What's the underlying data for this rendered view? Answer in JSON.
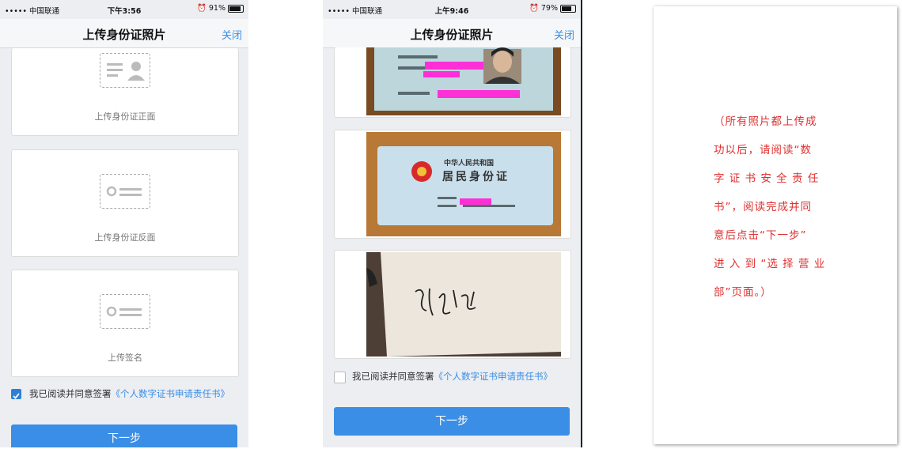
{
  "left_phone": {
    "status": {
      "carrier": "••••• 中国联通",
      "time": "下午3:56",
      "battery": "91%",
      "battery_level": 0.91
    },
    "nav": {
      "title": "上传身份证照片",
      "close": "关闭"
    },
    "cards": [
      {
        "label": "上传身份证正面"
      },
      {
        "label": "上传身份证反面"
      },
      {
        "label": "上传签名"
      }
    ],
    "agreement": {
      "checked": true,
      "text": "我已阅读并同意签署",
      "link": "《个人数字证书申请责任书》"
    },
    "button": "下一步"
  },
  "right_phone": {
    "status": {
      "carrier": "••••• 中国联通",
      "time": "上午9:46",
      "battery": "79%",
      "battery_level": 0.79
    },
    "nav": {
      "title": "上传身份证照片",
      "close": "关闭"
    },
    "id_back": {
      "line1": "中华人民共和国",
      "line2": "居民身份证"
    },
    "agreement": {
      "checked": false,
      "text": "我已阅读并同意签署",
      "link": "《个人数字证书申请责任书》"
    },
    "button": "下一步"
  },
  "note": {
    "lines": [
      "（所有照片都上传成",
      "功以后，请阅读“数",
      "字 证 书 安 全 责 任",
      "书”，阅读完成并同",
      "意后点击“下一步”",
      "进 入 到 “选 择 营 业",
      "部”页面。）"
    ]
  }
}
